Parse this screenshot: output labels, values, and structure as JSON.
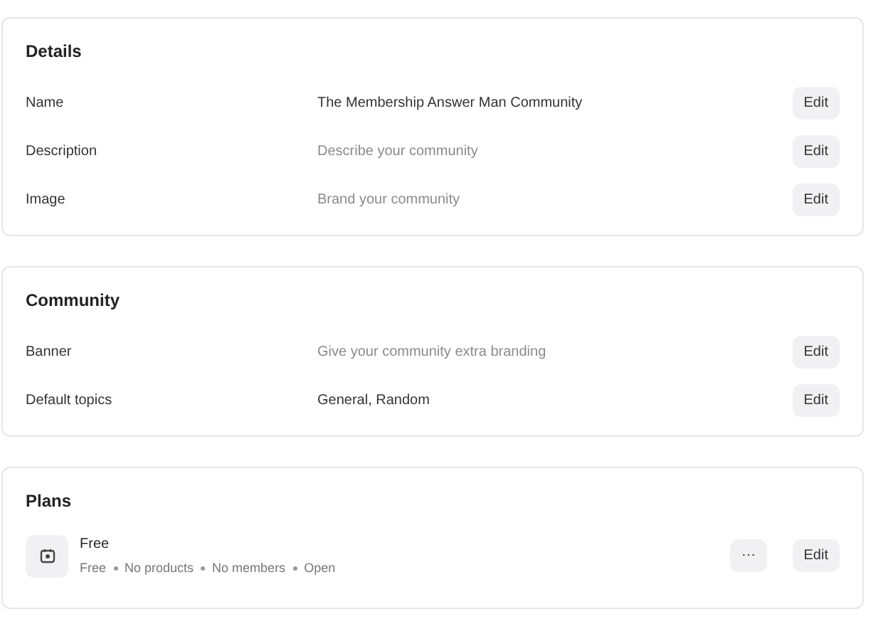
{
  "sections": [
    {
      "title": "Details",
      "rows": [
        {
          "label": "Name",
          "value": "The Membership Answer Man Community",
          "empty": false,
          "action": "Edit"
        },
        {
          "label": "Description",
          "value": "Describe your community",
          "empty": true,
          "action": "Edit"
        },
        {
          "label": "Image",
          "value": "Brand your community",
          "empty": true,
          "action": "Edit"
        }
      ]
    },
    {
      "title": "Community",
      "rows": [
        {
          "label": "Banner",
          "value": "Give your community extra branding",
          "empty": true,
          "action": "Edit"
        },
        {
          "label": "Default topics",
          "value": "General, Random",
          "empty": false,
          "action": "Edit"
        }
      ]
    }
  ],
  "plans": {
    "title": "Plans",
    "items": [
      {
        "name": "Free",
        "meta": [
          "Free",
          "No products",
          "No members",
          "Open"
        ],
        "more": "⋯",
        "action": "Edit"
      }
    ]
  }
}
